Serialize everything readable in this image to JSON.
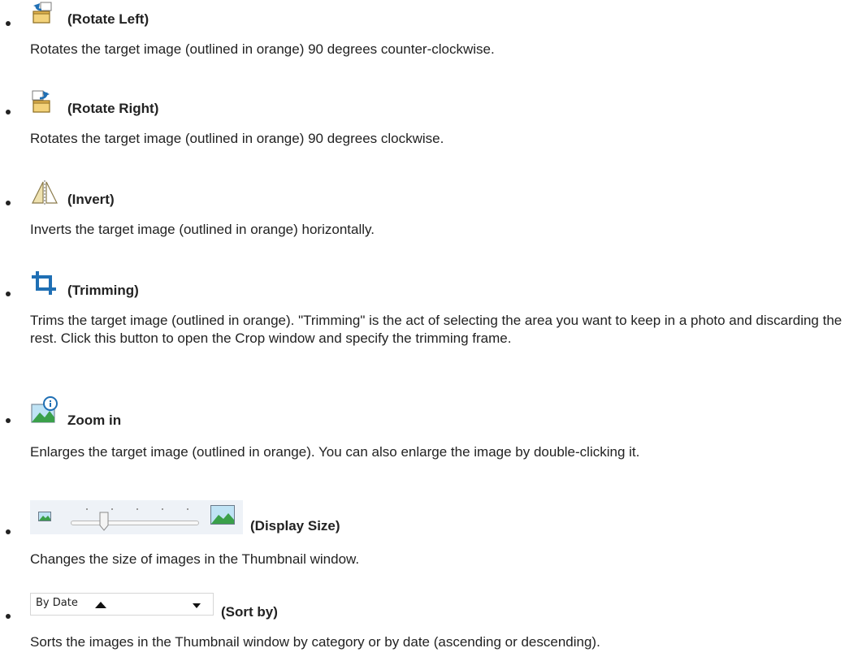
{
  "items": [
    {
      "icon": "rotate-left-icon",
      "term": "(Rotate Left)",
      "desc": "Rotates the target image (outlined in orange) 90 degrees counter-clockwise."
    },
    {
      "icon": "rotate-right-icon",
      "term": "(Rotate Right)",
      "desc": "Rotates the target image (outlined in orange) 90 degrees clockwise."
    },
    {
      "icon": "invert-icon",
      "term": "(Invert)",
      "desc": "Inverts the target image (outlined in orange) horizontally."
    },
    {
      "icon": "trimming-icon",
      "term": "(Trimming)",
      "desc": "Trims the target image (outlined in orange). \"Trimming\" is the act of selecting the area you want to keep in a photo and discarding the rest. Click this button to open the Crop window and specify the trimming frame."
    },
    {
      "icon": "zoom-in-icon",
      "term": "Zoom in",
      "desc": "Enlarges the target image (outlined in orange). You can also enlarge the image by double-clicking it."
    },
    {
      "icon": "display-size-slider",
      "term": "(Display Size)",
      "desc": "Changes the size of images in the Thumbnail window.",
      "slider_value": 0.25
    },
    {
      "icon": "sort-by-dropdown",
      "term": "(Sort by)",
      "desc": "Sorts the images in the Thumbnail window by category or by date (ascending or descending).",
      "dropdown_value": "By Date"
    }
  ],
  "colors": {
    "text": "#222222",
    "icon_blue": "#1f6fb4",
    "folder_yellow": "#f3d27a",
    "slider_bg": "#eef2f7"
  }
}
